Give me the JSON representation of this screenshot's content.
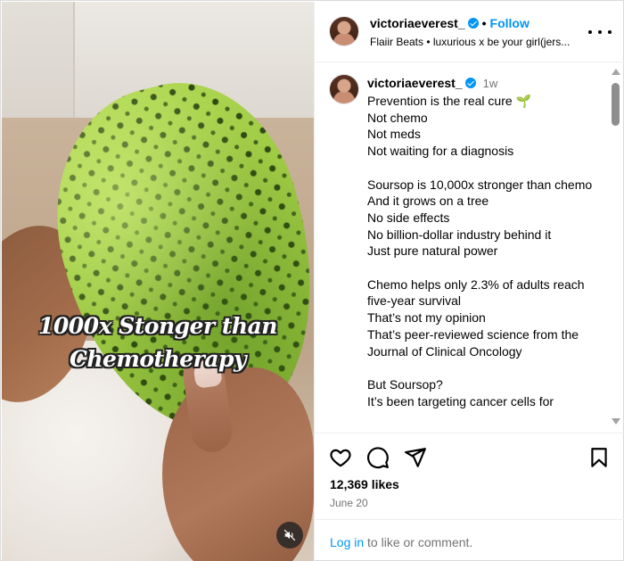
{
  "media": {
    "overlay_line1": "1000x Stonger than",
    "overlay_line2": "Chemotherapy"
  },
  "header": {
    "username": "victoriaeverest_",
    "separator": "•",
    "follow_label": "Follow",
    "audio": "Flaiir Beats • luxurious x be your girl(jers..."
  },
  "caption": {
    "username": "victoriaeverest_",
    "time": "1w",
    "first_line": "Prevention is the real cure",
    "emoji": "🌱",
    "body": "\nNot chemo\nNot meds\nNot waiting for a diagnosis\n\nSoursop is 10,000x stronger than chemo\nAnd it grows on a tree\nNo side effects\nNo billion-dollar industry behind it\nJust pure natural power\n\nChemo helps only 2.3% of adults reach five-year survival\nThat’s not my opinion\nThat’s peer-reviewed science from the Journal of Clinical Oncology\n\nBut Soursop?\nIt’s been targeting cancer cells for"
  },
  "actions": {
    "likes": "12,369 likes",
    "date": "June 20"
  },
  "login": {
    "link": "Log in",
    "rest": " to like or comment."
  },
  "icons": [
    "mute-icon",
    "verified-icon",
    "more-options-icon",
    "heart-icon",
    "comment-icon",
    "share-icon",
    "save-icon",
    "scroll-up-arrow-icon",
    "scroll-down-arrow-icon"
  ],
  "colors": {
    "accent": "#0095f6",
    "muted": "#737373",
    "border": "#dbdbdb"
  }
}
